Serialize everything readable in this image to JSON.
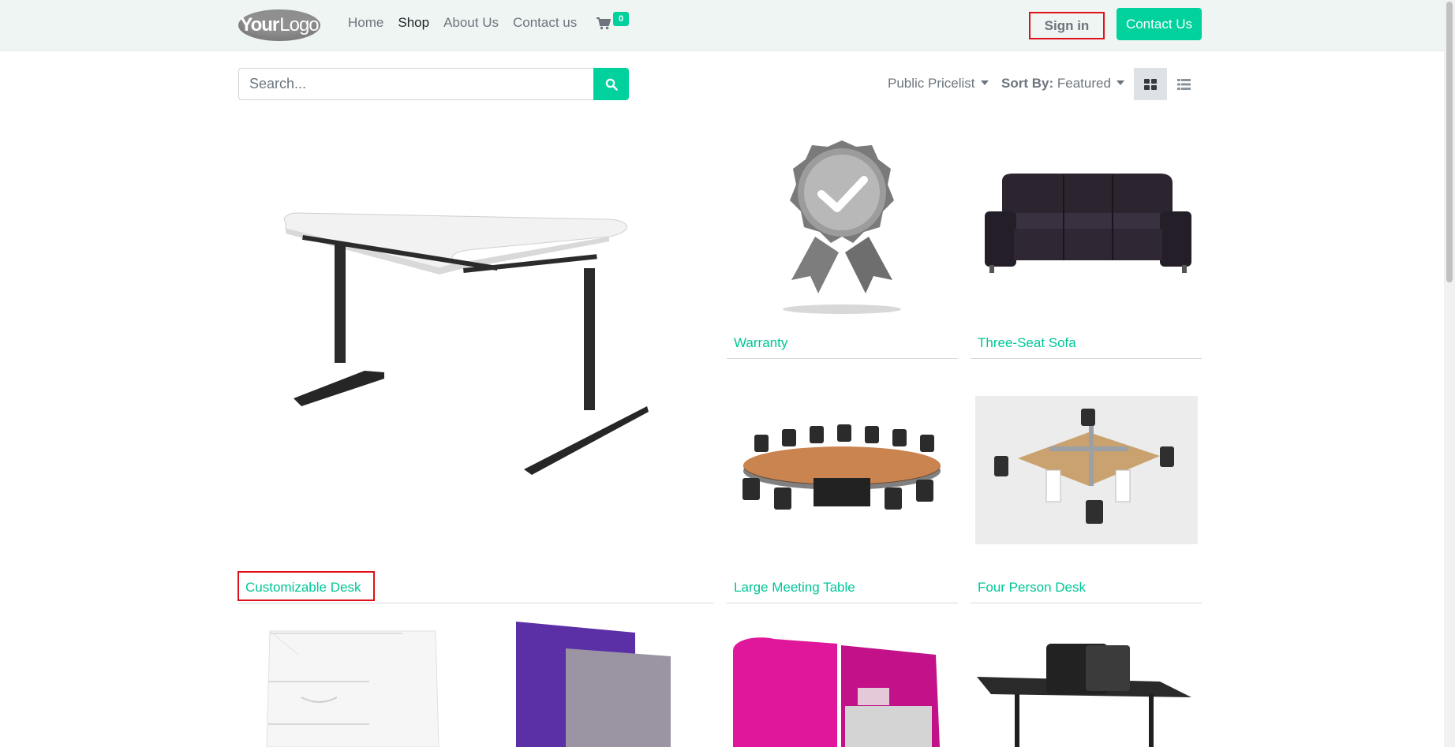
{
  "header": {
    "logo_bold": "Your",
    "logo_light": "Logo",
    "nav": [
      {
        "label": "Home"
      },
      {
        "label": "Shop"
      },
      {
        "label": "About Us"
      },
      {
        "label": "Contact us"
      }
    ],
    "active_nav": "Shop",
    "cart_count": "0",
    "sign_in": "Sign in",
    "contact_button": "Contact Us"
  },
  "toolbar": {
    "search_placeholder": "Search...",
    "pricelist": "Public Pricelist",
    "sort_label": "Sort By:",
    "sort_value": "Featured"
  },
  "products": [
    {
      "name": "Customizable Desk"
    },
    {
      "name": "Warranty"
    },
    {
      "name": "Three-Seat Sofa"
    },
    {
      "name": "Large Meeting Table"
    },
    {
      "name": "Four Person Desk"
    }
  ],
  "colors": {
    "accent": "#00d19d",
    "header_bg": "#eef5f2",
    "highlight": "#e0101a"
  }
}
